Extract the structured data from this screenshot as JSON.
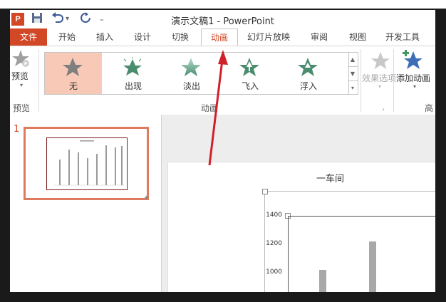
{
  "window": {
    "title": "演示文稿1 - PowerPoint",
    "app_logo": "P",
    "quick_access": [
      {
        "icon": "save-icon",
        "glyph": "💾"
      },
      {
        "icon": "undo-icon",
        "glyph": "↶"
      },
      {
        "icon": "redo-icon",
        "glyph": "↻"
      },
      {
        "icon": "customize-icon",
        "glyph": "="
      }
    ]
  },
  "tabs": [
    {
      "label": "文件"
    },
    {
      "label": "开始"
    },
    {
      "label": "插入"
    },
    {
      "label": "设计"
    },
    {
      "label": "切换"
    },
    {
      "label": "动画"
    },
    {
      "label": "幻灯片放映"
    },
    {
      "label": "审阅"
    },
    {
      "label": "视图"
    },
    {
      "label": "开发工具"
    }
  ],
  "ribbon": {
    "preview": {
      "label": "预览",
      "group_label": "预览"
    },
    "gallery": [
      {
        "label": "无",
        "icon": "star-icon",
        "color": "#7f7f7f",
        "selected": true
      },
      {
        "label": "出现",
        "icon": "star-burst-icon",
        "color": "#4a8c6e"
      },
      {
        "label": "淡出",
        "icon": "star-fade-icon",
        "color": "#6fae8f"
      },
      {
        "label": "飞入",
        "icon": "star-fly-icon",
        "color": "#4a8c6e"
      },
      {
        "label": "浮入",
        "icon": "star-float-icon",
        "color": "#4a8c6e"
      }
    ],
    "animation_group_label": "动画",
    "effect_options": {
      "label": "效果选项"
    },
    "add_animation": {
      "label": "添加动画"
    },
    "advanced_group_label": "高"
  },
  "slide_panel": {
    "number": "1"
  },
  "chart": {
    "title": "一车间",
    "y_ticks": [
      "1400",
      "1200",
      "1000"
    ]
  },
  "colors": {
    "accent": "#d24726",
    "selected": "#f7c9b6",
    "arrow": "#d0202a"
  }
}
